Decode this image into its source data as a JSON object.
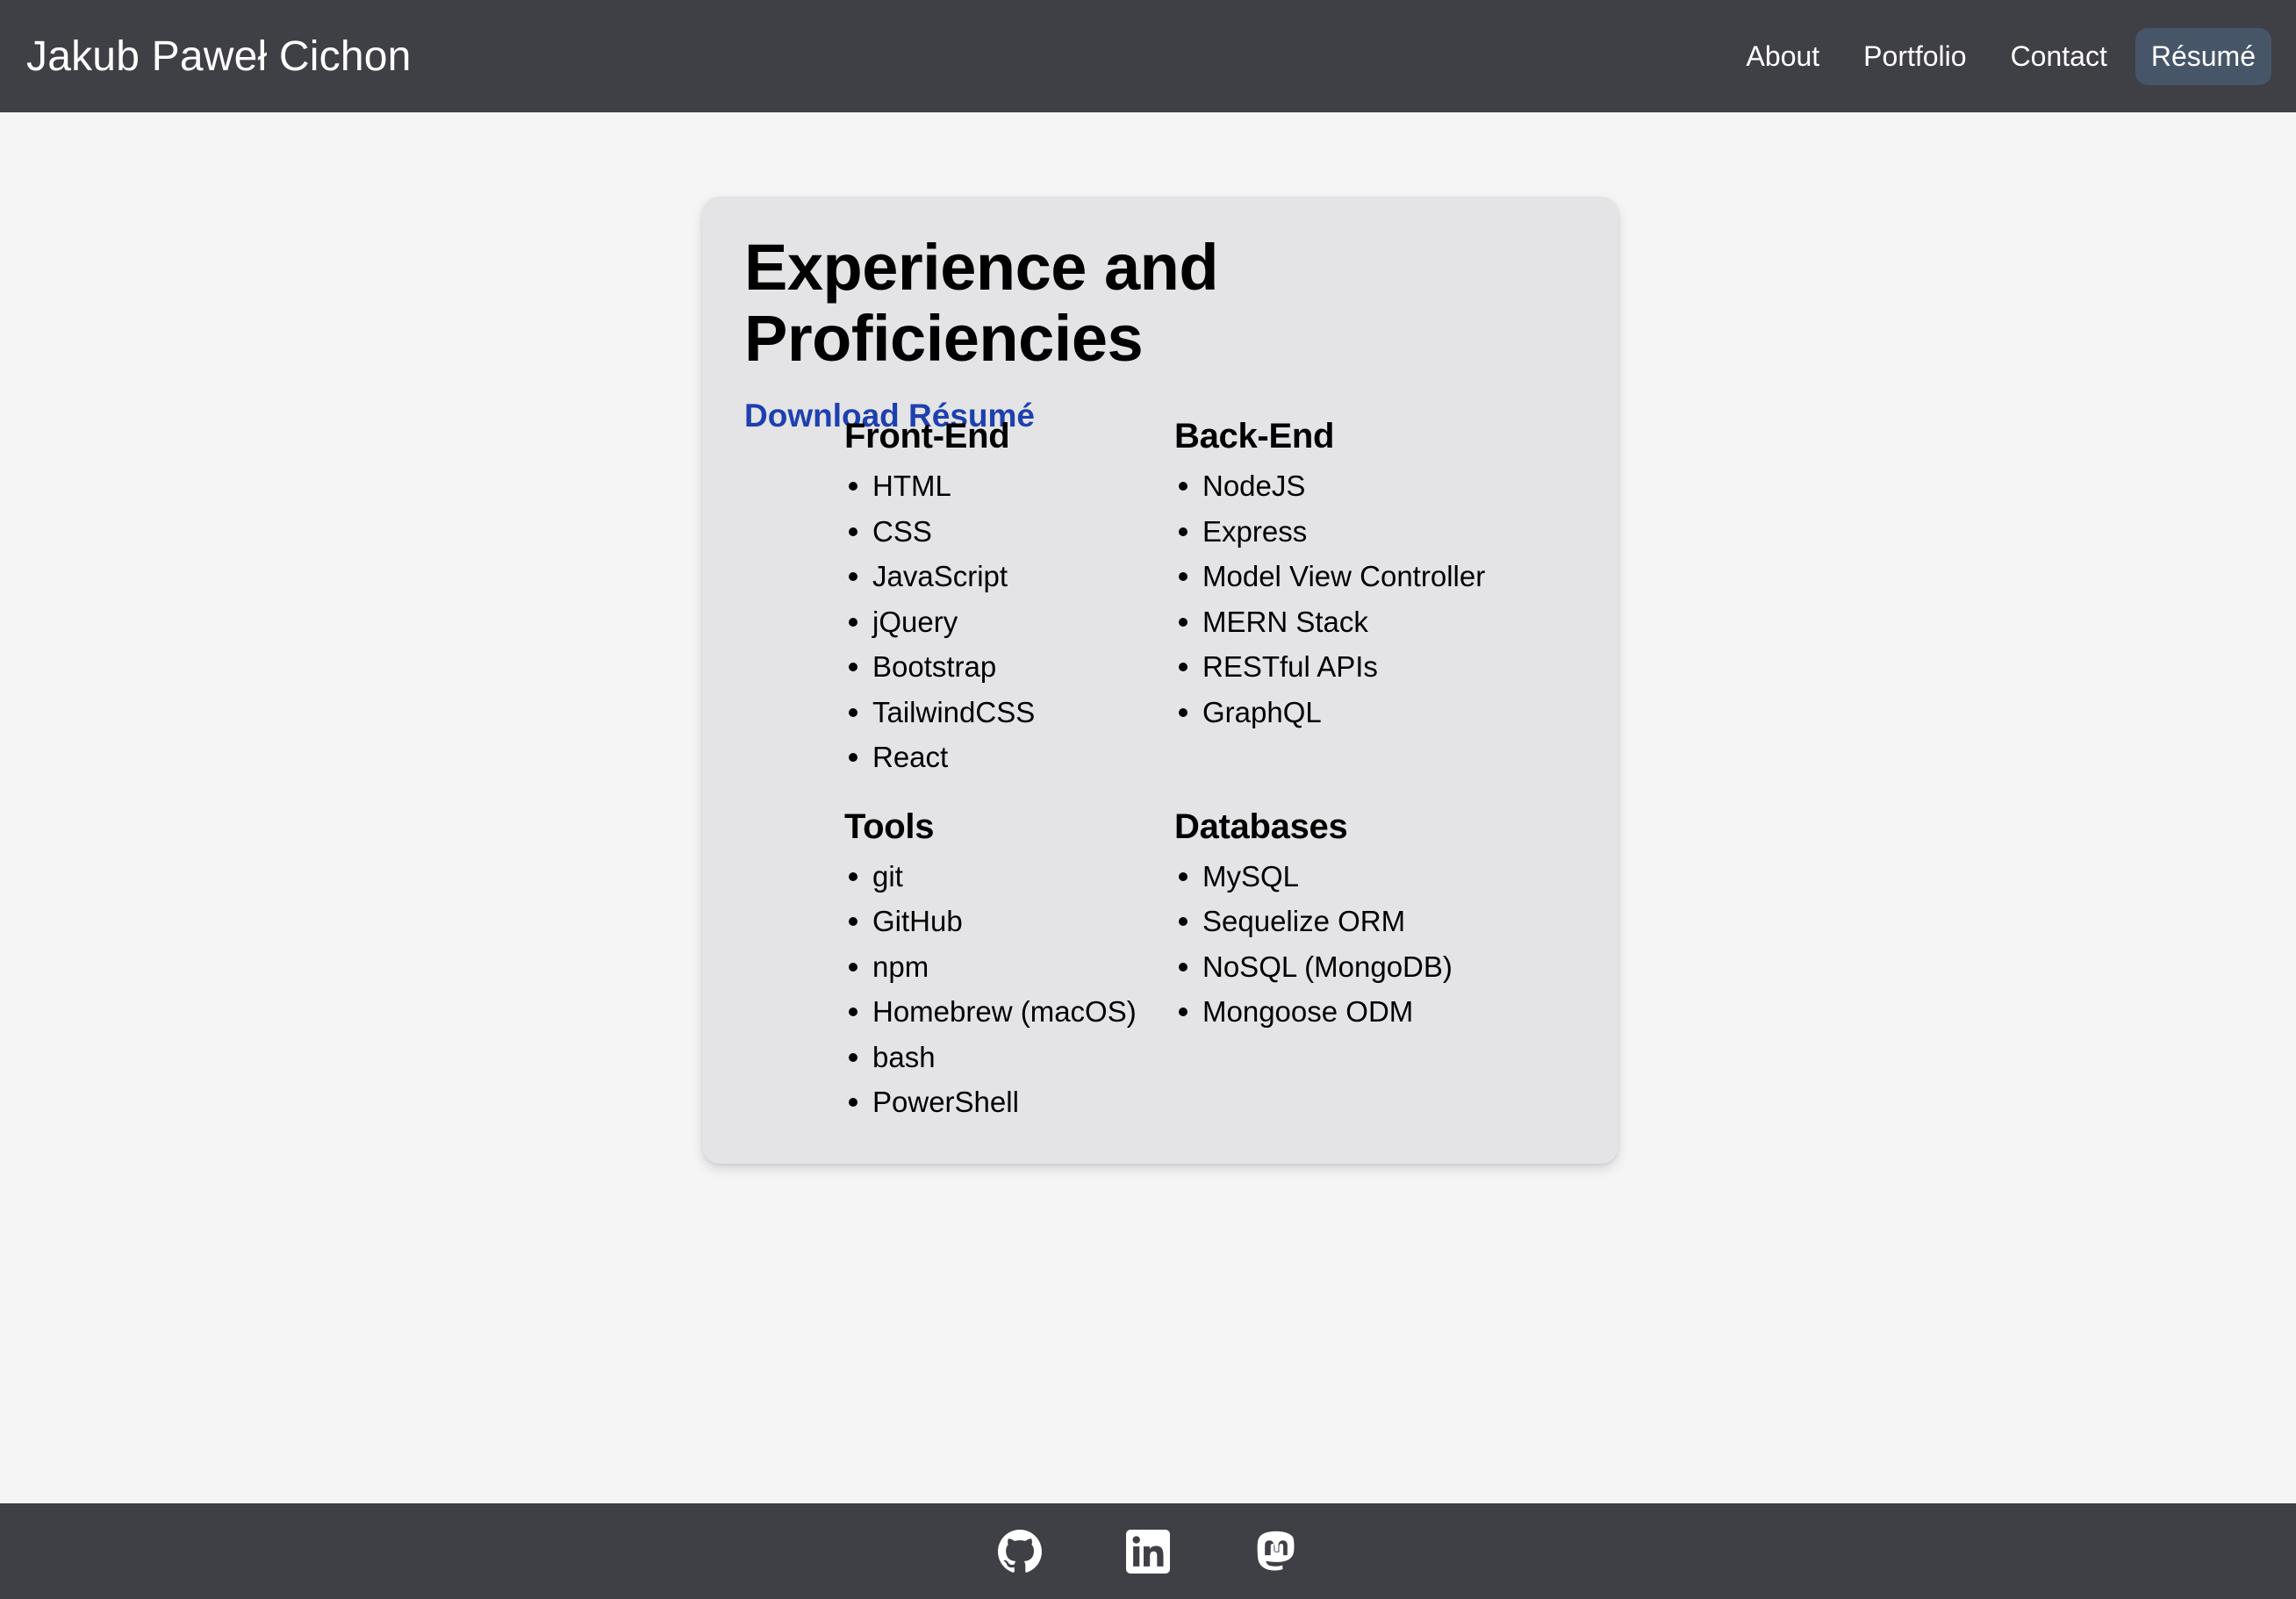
{
  "header": {
    "site_title": "Jakub Paweł Cichon",
    "nav": [
      {
        "label": "About"
      },
      {
        "label": "Portfolio"
      },
      {
        "label": "Contact"
      },
      {
        "label": "Résumé",
        "active": true
      }
    ]
  },
  "main": {
    "title": "Experience and Proficiencies",
    "download_label": "Download Résumé",
    "sections": [
      {
        "title": "Front-End",
        "items": [
          "HTML",
          "CSS",
          "JavaScript",
          "jQuery",
          "Bootstrap",
          "TailwindCSS",
          "React"
        ]
      },
      {
        "title": "Back-End",
        "items": [
          "NodeJS",
          "Express",
          "Model View Controller",
          "MERN Stack",
          "RESTful APIs",
          "GraphQL"
        ]
      },
      {
        "title": "Tools",
        "items": [
          "git",
          "GitHub",
          "npm",
          "Homebrew (macOS)",
          "bash",
          "PowerShell"
        ]
      },
      {
        "title": "Databases",
        "items": [
          "MySQL",
          "Sequelize ORM",
          "NoSQL (MongoDB)",
          "Mongoose ODM"
        ]
      }
    ]
  },
  "footer": {
    "icons": [
      "github-icon",
      "linkedin-icon",
      "mastodon-icon"
    ]
  },
  "colors": {
    "header_bg": "#3f3f46",
    "active_nav_bg": "#475569",
    "card_bg": "#e4e4e7",
    "link": "#1e40af",
    "page_bg": "#f5f5f5"
  }
}
